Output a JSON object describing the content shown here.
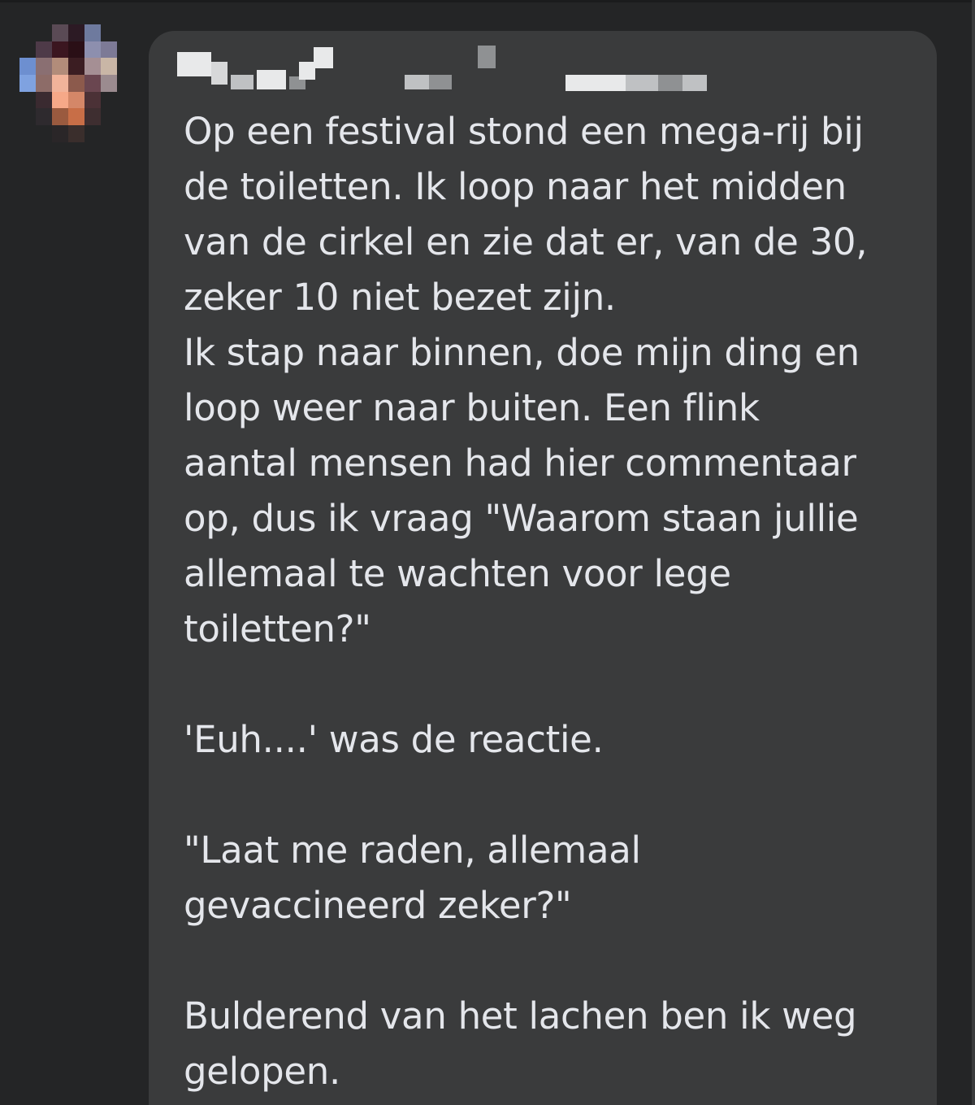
{
  "comment": {
    "lines": [
      "Op een festival stond een mega-rij bij",
      "de toiletten. Ik loop naar het midden",
      "van de cirkel en zie dat er, van de 30,",
      "zeker 10 niet bezet zijn.",
      "Ik stap naar binnen, doe mijn ding en",
      "loop weer naar buiten. Een flink",
      "aantal mensen had hier commentaar",
      "op, dus ik vraag \"Waarom staan jullie",
      "allemaal te wachten voor lege",
      "toiletten?\"",
      "",
      "'Euh....' was de reactie.",
      "",
      "\"Laat me raden, allemaal",
      "gevaccineerd zeker?\"",
      "",
      "Bulderend van het lachen ben ik weg",
      "gelopen."
    ]
  },
  "colors": {
    "background": "#242526",
    "bubble": "#3a3b3c",
    "text": "#e4e6eb"
  },
  "icons": {
    "avatar": "pixelated-profile-photo",
    "author": "pixelated-author-name"
  }
}
